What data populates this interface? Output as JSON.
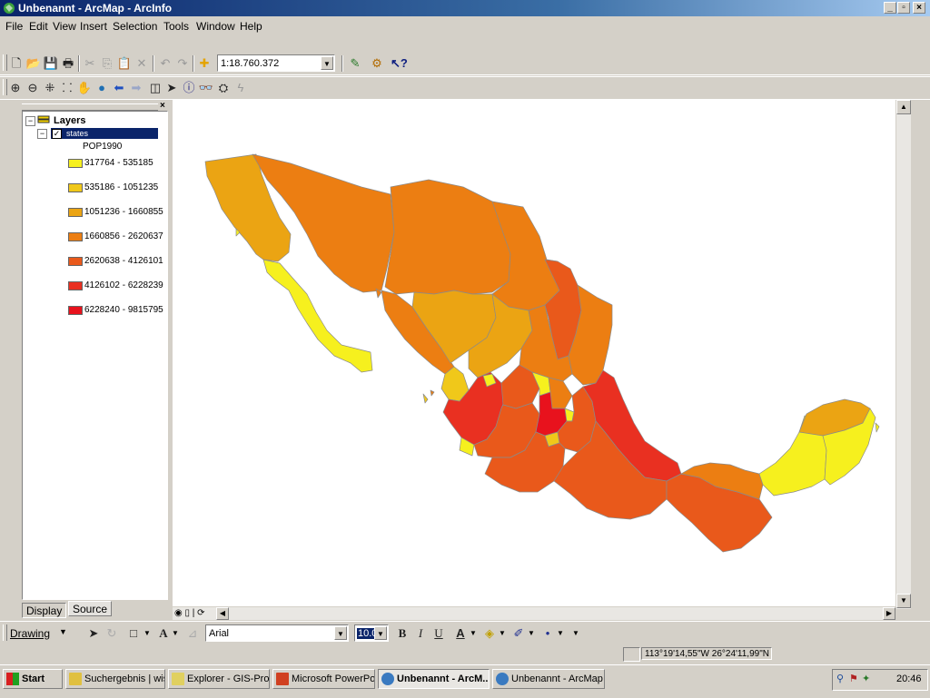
{
  "window": {
    "title": "Unbenannt - ArcMap - ArcInfo"
  },
  "menu": [
    "File",
    "Edit",
    "View",
    "Insert",
    "Selection",
    "Tools",
    "Window",
    "Help"
  ],
  "toolbar": {
    "scale": "1:18.760.372"
  },
  "toc": {
    "root": "Layers",
    "layer": "states",
    "field": "POP1990",
    "classes": [
      {
        "label": "317764 - 535185",
        "color": "#f6f01e"
      },
      {
        "label": "535186 - 1051235",
        "color": "#f0c81a"
      },
      {
        "label": "1051236 - 1660855",
        "color": "#eba413"
      },
      {
        "label": "1660856 - 2620637",
        "color": "#ec7e12"
      },
      {
        "label": "2620638 - 4126101",
        "color": "#e9591b"
      },
      {
        "label": "4126102 - 6228239",
        "color": "#e93021"
      },
      {
        "label": "6228240 - 9815795",
        "color": "#e8121d"
      }
    ],
    "tabs": [
      "Display",
      "Source"
    ]
  },
  "drawing": {
    "label": "Drawing",
    "font": "Arial",
    "size": "10.0"
  },
  "status": {
    "coords": "113°19'14,55\"W  26°24'11,99\"N"
  },
  "taskbar": {
    "start": "Start",
    "items": [
      "Suchergebnis | wisse...",
      "Explorer - GIS-Prose...",
      "Microsoft PowerPoint...",
      "Unbenannt - ArcM...",
      "Unbenannt - ArcMap ..."
    ],
    "clock": "20:46"
  },
  "colors": {
    "titlebar": "#0a246a",
    "selection": "#0a246a"
  }
}
